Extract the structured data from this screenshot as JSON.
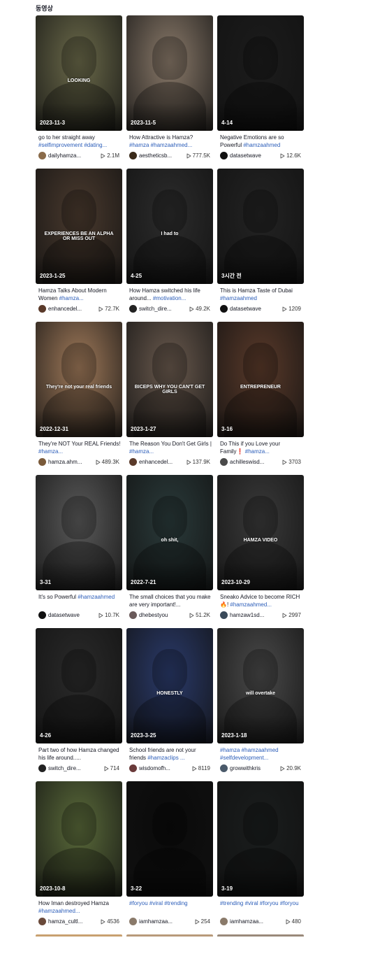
{
  "section_title": "동영상",
  "colors": {
    "hashtag": "#2b5db9",
    "text": "#161823"
  },
  "videos": [
    {
      "date": "2023-11-3",
      "overlay": "LOOKING",
      "caption": "go to her straight away ",
      "tags": "#selfimprovement #dating...",
      "author": "dailyhamza...",
      "views": "2.1M",
      "bg": "#6b6a4a",
      "avatar": "#8a6b4a"
    },
    {
      "date": "2023-11-5",
      "overlay": "",
      "caption": "How Attractive is Hamza? ",
      "tags": "#hamza #hamzaahmed...",
      "author": "aestheticsb...",
      "views": "777.5K",
      "bg": "#8a7a6a",
      "avatar": "#3a2a1a"
    },
    {
      "date": "4-14",
      "overlay": "",
      "caption": "Negative Emotions are so Powerful ",
      "tags": "#hamzaahmed",
      "author": "datasetwave",
      "views": "12.6K",
      "bg": "#1c1c1c",
      "avatar": "#111111"
    },
    {
      "date": "2023-1-25",
      "overlay": "EXPERIENCES  BE AN ALPHA OR MISS OUT",
      "caption": "Hamza Talks About Modern Women ",
      "tags": "#hamza...",
      "author": "enhancedel...",
      "views": "72.7K",
      "bg": "#4a3a2e",
      "avatar": "#5a3a2a"
    },
    {
      "date": "4-25",
      "overlay": "I had to",
      "caption": "How Hamza switched his life around... ",
      "tags": "#motivation...",
      "author": "switch_dire...",
      "views": "49.2K",
      "bg": "#2c2c2c",
      "avatar": "#222222"
    },
    {
      "date": "3시간 전",
      "overlay": "",
      "caption": "This is Hamza Taste of Dubai ",
      "tags": "#hamzaahmed",
      "author": "datasetwave",
      "views": "1209",
      "bg": "#232323",
      "avatar": "#111111"
    },
    {
      "date": "2022-12-31",
      "overlay": "They're not your real friends",
      "caption": "They're NOT Your REAL Friends! ",
      "tags": "#hamza...",
      "author": "hamza.ahm...",
      "views": "489.3K",
      "bg": "#a07a5a",
      "avatar": "#7a5a3a"
    },
    {
      "date": "2023-1-27",
      "overlay": "BICEPS  WHY YOU CAN'T GET GIRLS",
      "caption": "The Reason You Don't Get Girls | ",
      "tags": "#hamza...",
      "author": "enhancedel...",
      "views": "137.9K",
      "bg": "#6a5a4e",
      "avatar": "#5a3a2a"
    },
    {
      "date": "3-16",
      "overlay": "ENTREPRENEUR",
      "caption": "Do This if you Love your Family❗ ",
      "tags": "#hamza...",
      "author": "achilleswisd...",
      "views": "3703",
      "bg": "#5a3a2a",
      "avatar": "#4a4a4a"
    },
    {
      "date": "3-31",
      "overlay": "",
      "caption": "It's so Powerful ",
      "tags": "#hamzaahmed",
      "author": "datasetwave",
      "views": "10.7K",
      "bg": "#5a5a5a",
      "avatar": "#111111"
    },
    {
      "date": "2022-7-21",
      "overlay": "oh shit,",
      "caption": "The small choices that you make are very important!...",
      "tags": "",
      "author": "dhebestyou",
      "views": "51.2K",
      "bg": "#2a3a3a",
      "avatar": "#6a5a5a"
    },
    {
      "date": "2023-10-29",
      "overlay": "HAMZA VIDEO",
      "caption": "Sneako Advice to become RICH🔥! ",
      "tags": "#hamzaahmed...",
      "author": "hamzaw1sd...",
      "views": "2997",
      "bg": "#3a3a3a",
      "avatar": "#3a4a5a"
    },
    {
      "date": "4-26",
      "overlay": "",
      "caption": "Part two of how Hamza changed his life around.....",
      "tags": "",
      "author": "switch_dire...",
      "views": "714",
      "bg": "#2a2a2a",
      "avatar": "#222222"
    },
    {
      "date": "2023-3-25",
      "overlay": "HONESTLY",
      "caption": "School friends are not your friends ",
      "tags": "#hamzaclips ...",
      "author": "wisdomofh...",
      "views": "8119",
      "bg": "#2a3a6a",
      "avatar": "#6a3a3a"
    },
    {
      "date": "2023-1-18",
      "overlay": "will overtake",
      "caption": "",
      "tags": "#hamza #hamzaahmed #selfdevelopment...",
      "author": "growwithkris",
      "views": "20.9K",
      "bg": "#4a4a4a",
      "avatar": "#4a5a6a"
    },
    {
      "date": "2023-10-8",
      "overlay": "",
      "caption": "How Iman destroyed Hamza ",
      "tags": "#hamzaahmed...",
      "author": "hamza_cultl...",
      "views": "4536",
      "bg": "#5a6a3a",
      "avatar": "#6a4a3a"
    },
    {
      "date": "3-22",
      "overlay": "",
      "caption": "",
      "tags": "#foryou #viral #trending",
      "author": "iamhamzaa...",
      "views": "254",
      "bg": "#0a0a0a",
      "avatar": "#8a7a6a"
    },
    {
      "date": "3-19",
      "overlay": "",
      "caption": "",
      "tags": "#trending #viral #foryou #foryou",
      "author": "iamhamzaa...",
      "views": "480",
      "bg": "#1a1d1d",
      "avatar": "#8a7a6a"
    }
  ]
}
